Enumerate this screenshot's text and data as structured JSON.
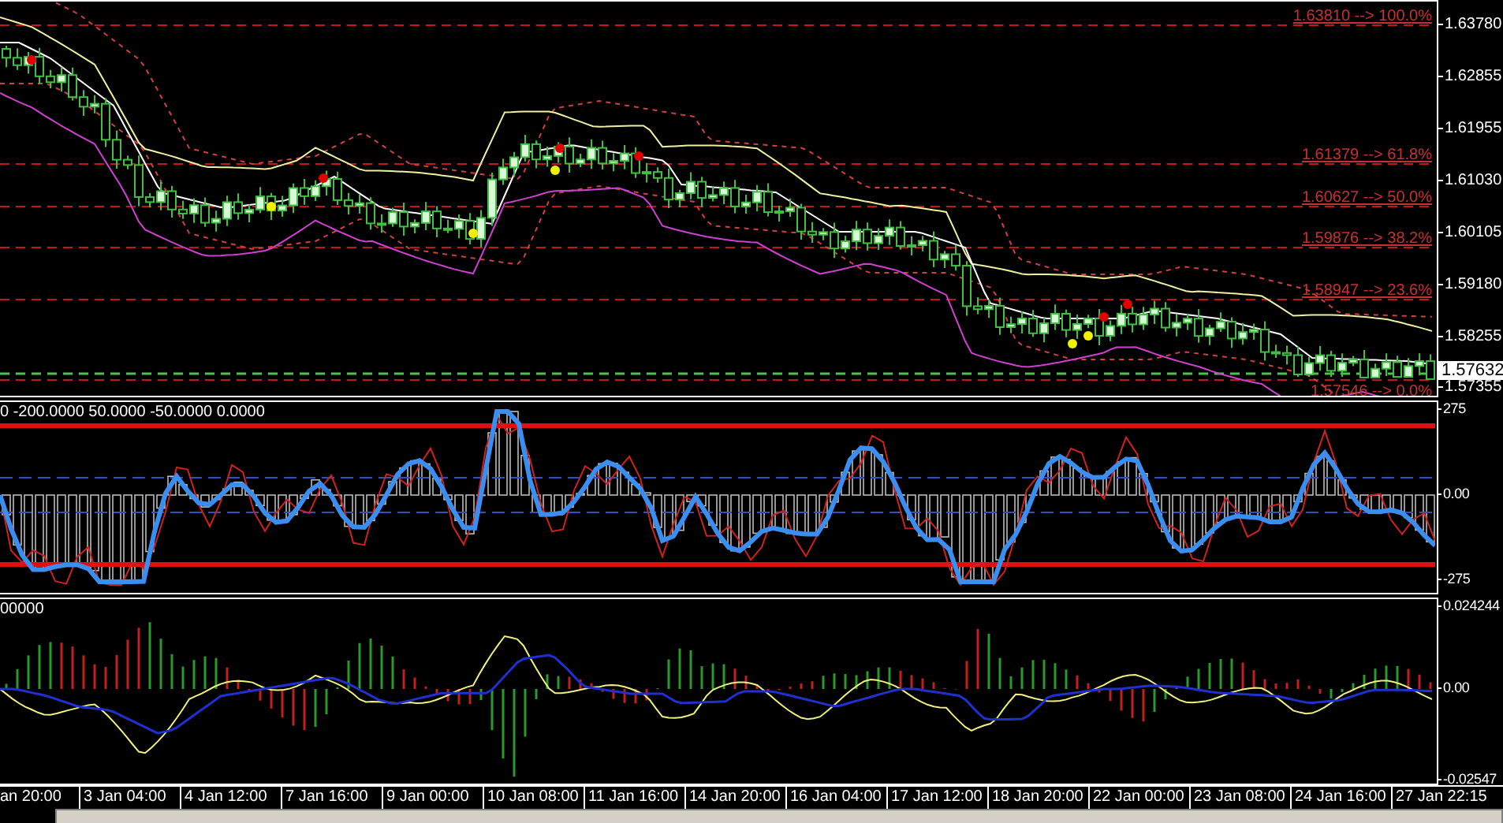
{
  "price_panel": {
    "fib_levels": [
      {
        "label": "1.63810 --> 100.0%"
      },
      {
        "label": "1.61379 --> 61.8%"
      },
      {
        "label": "1.60627 --> 50.0%"
      },
      {
        "label": "1.59876 --> 38.2%"
      },
      {
        "label": "1.58947 --> 23.6%"
      },
      {
        "label": "1.57546 --> 0.0%"
      }
    ],
    "price_axis": [
      "1.63780",
      "1.62855",
      "1.61955",
      "1.61030",
      "1.60105",
      "1.59180",
      "1.58255",
      "1.57355"
    ],
    "current_price": "1.57632"
  },
  "cci_panel": {
    "title": "0 -200.0000 50.0000 -50.0000 0.0000",
    "axis": [
      "275",
      "0.00",
      "-275"
    ]
  },
  "macd_panel": {
    "title": "00000",
    "axis": [
      "0.024244",
      "0.00",
      "-0.02547"
    ]
  },
  "time_axis": [
    "an 20:00",
    "3 Jan 04:00",
    "4 Jan 12:00",
    "7 Jan 16:00",
    "9 Jan 00:00",
    "10 Jan 08:00",
    "11 Jan 16:00",
    "14 Jan 20:00",
    "16 Jan 04:00",
    "17 Jan 12:00",
    "18 Jan 20:00",
    "22 Jan 00:00",
    "23 Jan 08:00",
    "24 Jan 16:00",
    "27 Jan 22:15"
  ]
}
